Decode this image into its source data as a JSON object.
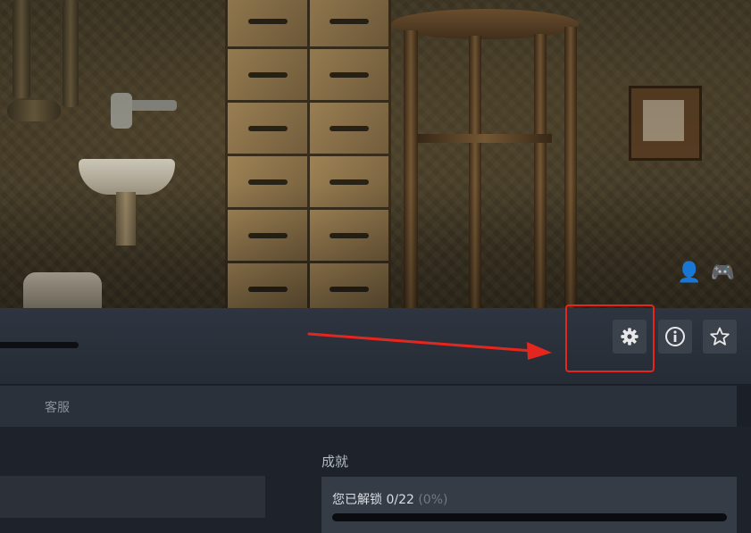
{
  "header": {
    "mode_icons": [
      {
        "name": "single-player-icon",
        "glyph": "👤"
      },
      {
        "name": "controller-icon",
        "glyph": "🎮"
      }
    ]
  },
  "toolbar": {
    "buttons": [
      {
        "name": "settings",
        "icon": "gear-icon"
      },
      {
        "name": "info",
        "icon": "info-icon"
      },
      {
        "name": "favorite",
        "icon": "star-icon"
      }
    ],
    "annotation_color": "#e5261f"
  },
  "tabs": {
    "support_label": "客服"
  },
  "achievements": {
    "section_title": "成就",
    "unlocked_text": "您已解锁 0/22",
    "percent_text": "(0%)",
    "progress_fraction": 0
  },
  "colors": {
    "background": "#1b2028",
    "button_bg": "#3c424c",
    "accent": "#3aa0e8"
  }
}
